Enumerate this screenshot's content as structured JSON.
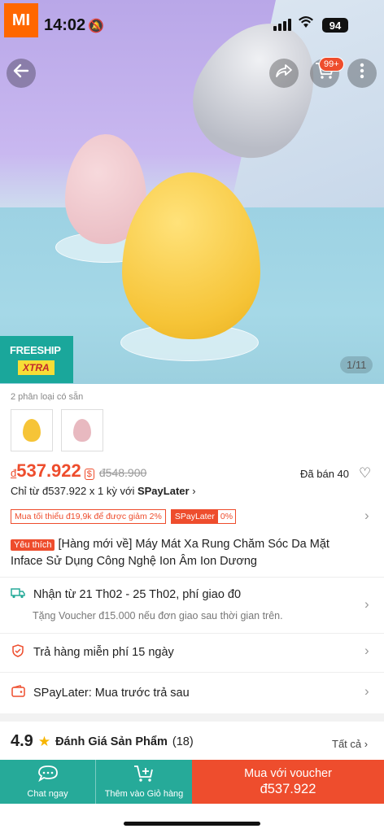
{
  "status_bar": {
    "brand": "MI",
    "time": "14:02",
    "battery": "94"
  },
  "header": {
    "cart_badge": "99+"
  },
  "hero": {
    "freeship_line1": "FREESHIP",
    "freeship_line2": "XTRA",
    "image_counter": "1/11"
  },
  "variants": {
    "label": "2 phân loại có sẵn",
    "colors": [
      "#f6c437",
      "#e8b9c0"
    ]
  },
  "price": {
    "currency": "đ",
    "value": "537.922",
    "original": "đ548.900",
    "sold": "Đã bán 40",
    "paylater_prefix": "Chỉ từ đ537.922 x 1 kỳ với ",
    "paylater_brand": "SPayLater",
    "paylater_chevron": "›"
  },
  "promo": {
    "min_discount": "Mua tối thiểu đ19,9k để được giảm 2%",
    "spaylater_tag": "SPayLater",
    "spaylater_rate": "0%"
  },
  "product": {
    "hot_tag": "Yêu thích",
    "title": "[Hàng mới về] Máy Mát Xa Rung Chăm Sóc Da Mặt Inface Sử Dụng Công Nghệ Ion Âm Ion Dương"
  },
  "shipping": {
    "line": "Nhận từ 21 Th02 - 25 Th02, phí giao đ0",
    "note": "Tặng Voucher đ15.000 nếu đơn giao sau thời gian trên."
  },
  "returns": {
    "line": "Trả hàng miễn phí 15 ngày"
  },
  "spaylater": {
    "line": "SPayLater: Mua trước trả sau"
  },
  "rating": {
    "score": "4.9",
    "label": "Đánh Giá Sản Phẩm",
    "count": "(18)",
    "see_all": "Tất cả"
  },
  "bottom_bar": {
    "chat_label": "Chat ngay",
    "cart_label": "Thêm vào Giỏ hàng",
    "buy_line1": "Mua với voucher",
    "buy_line2": "đ537.922"
  },
  "colors": {
    "accent": "#ee4d2d",
    "teal": "#26aa99"
  }
}
